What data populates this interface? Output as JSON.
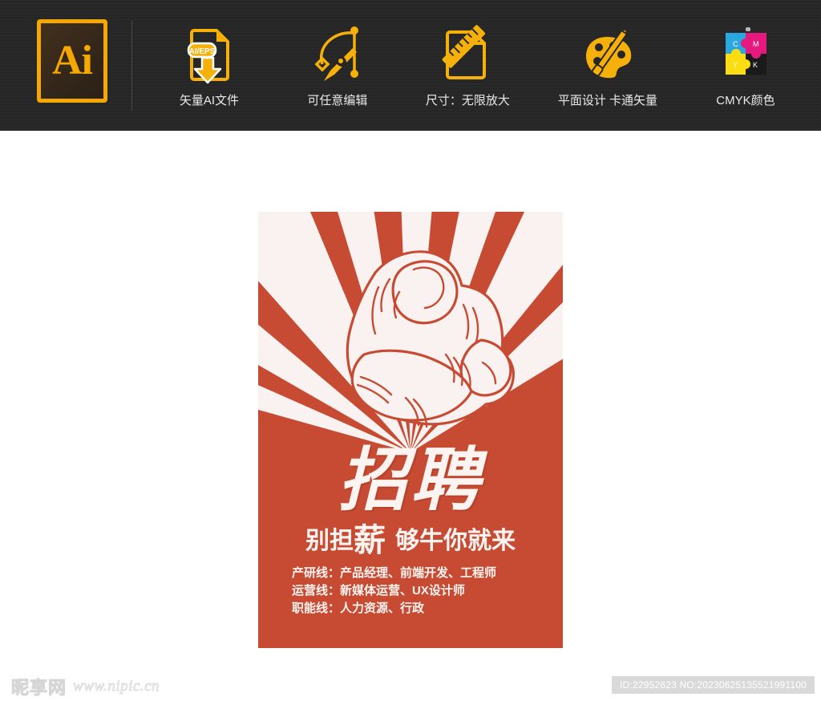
{
  "topbar": {
    "logo": {
      "text": "Ai",
      "border_color": "#f5a800",
      "fill_color": "#3b2c1c"
    },
    "features": [
      {
        "icon": "ai-eps-file-download-icon",
        "label": "矢量AI文件"
      },
      {
        "icon": "pen-tool-bezier-icon",
        "label": "可任意编辑"
      },
      {
        "icon": "document-ruler-icon",
        "label": "尺寸：无限放大"
      },
      {
        "icon": "palette-brush-icon",
        "label": "平面设计  卡通矢量"
      },
      {
        "icon": "cmyk-puzzle-icon",
        "label": "CMYK颜色"
      }
    ],
    "file_badge_text": "AI/EPS",
    "cmyk_letters": [
      "C",
      "M",
      "Y",
      "K"
    ],
    "background_color": "#262626"
  },
  "poster": {
    "background_color": "#c74b32",
    "ray_color": "#faf2f0",
    "title": "招聘",
    "subtitle_part1": "别担",
    "subtitle_highlight": "薪",
    "subtitle_part2": "够牛你就来",
    "jobs": [
      "产研线：产品经理、前端开发、工程师",
      "运营线：新媒体运营、UX设计师",
      "职能线：人力资源、行政"
    ]
  },
  "footer": {
    "watermark_cn": "昵享网",
    "watermark_url": "www.nipic.cn",
    "id_label": "ID:22952623 NO:20230625135521991100"
  }
}
